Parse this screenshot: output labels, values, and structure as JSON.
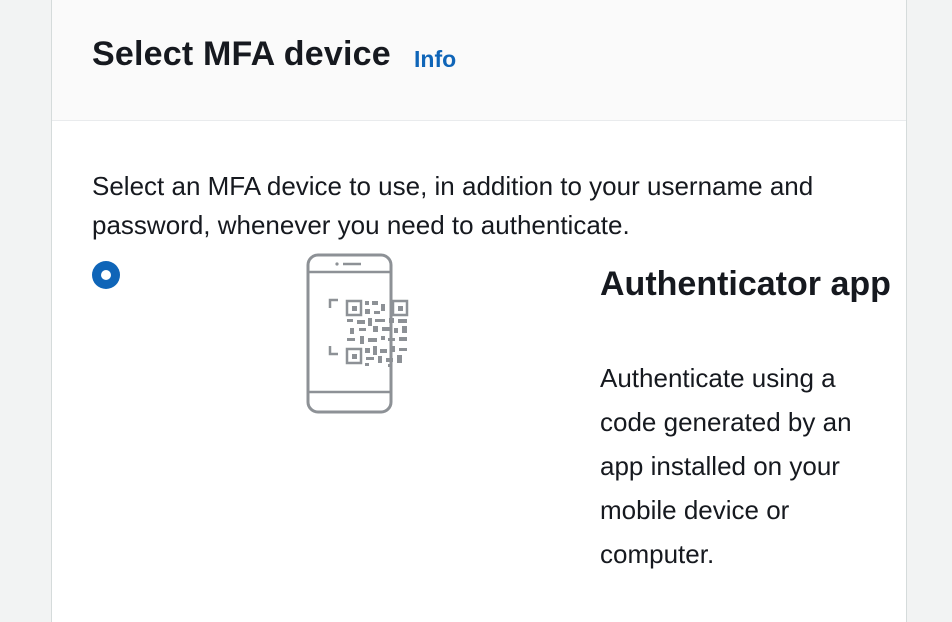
{
  "header": {
    "title": "Select MFA device",
    "info_label": "Info"
  },
  "main": {
    "description": "Select an MFA device to use, in addition to your username and password, whenever you need to authenticate.",
    "option": {
      "title": "Authenticator app",
      "description": "Authenticate using a code generated by an app installed on your mobile device or computer.",
      "selected": true,
      "icon": "phone-qr-code-icon"
    }
  },
  "colors": {
    "accent": "#0f65b8",
    "header_bg": "#fafafa",
    "page_bg": "#f2f3f3",
    "text": "#16191f"
  }
}
